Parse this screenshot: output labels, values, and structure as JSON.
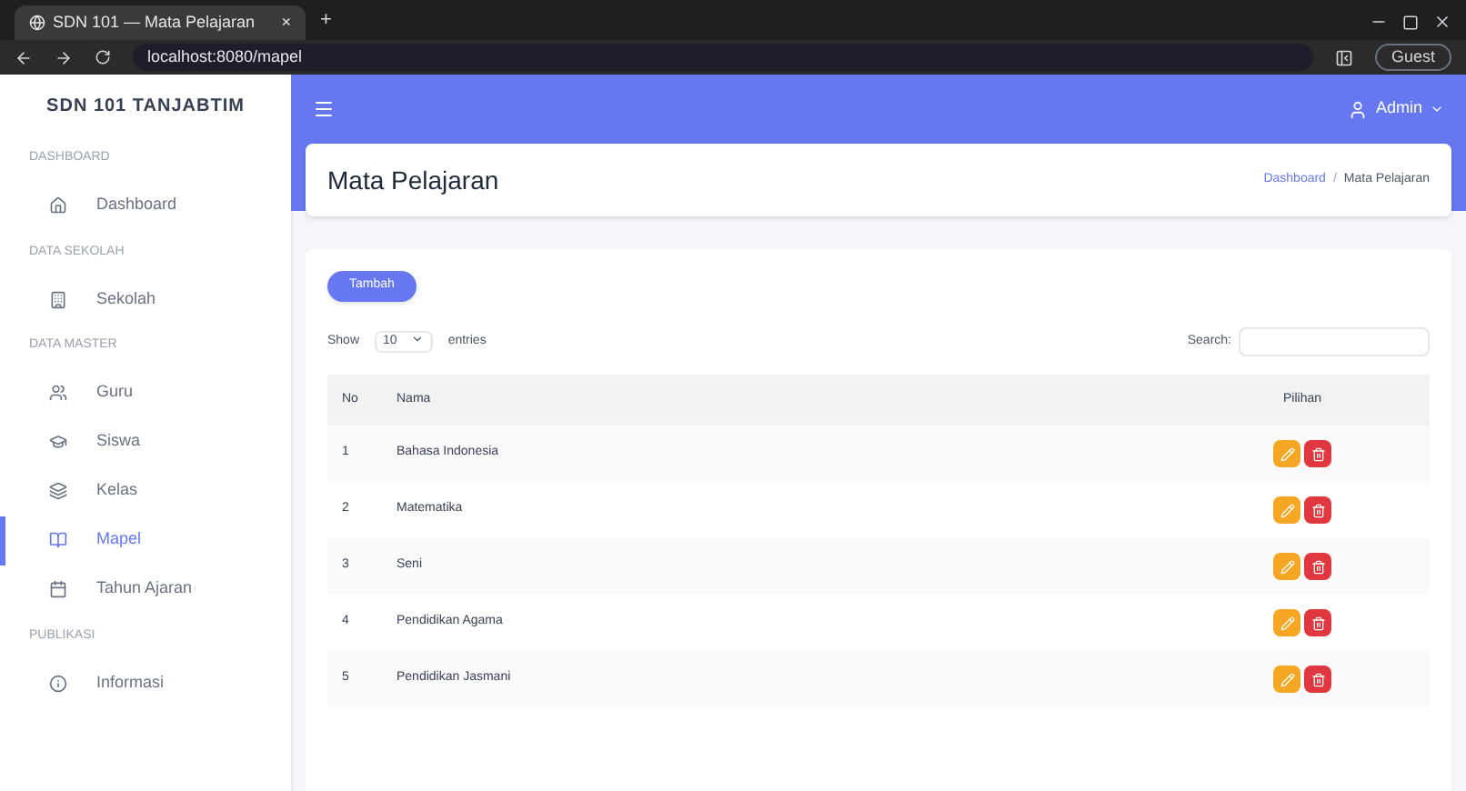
{
  "browser": {
    "tab_title": "SDN 101 — Mata Pelajaran",
    "tab_close": "×",
    "new_tab": "+",
    "url": "localhost:8080/mapel",
    "profile": "Guest"
  },
  "sidebar": {
    "brand": "SDN 101 TANJABTIM",
    "sections": [
      {
        "title": "DASHBOARD",
        "items": [
          {
            "label": "Dashboard",
            "selected": false
          }
        ]
      },
      {
        "title": "DATA SEKOLAH",
        "items": [
          {
            "label": "Sekolah",
            "selected": false
          }
        ]
      },
      {
        "title": "DATA MASTER",
        "items": [
          {
            "label": "Guru",
            "selected": false
          },
          {
            "label": "Siswa",
            "selected": false
          },
          {
            "label": "Kelas",
            "selected": false
          },
          {
            "label": "Mapel",
            "selected": true
          },
          {
            "label": "Tahun Ajaran",
            "selected": false
          }
        ]
      },
      {
        "title": "PUBLIKASI",
        "items": [
          {
            "label": "Informasi",
            "selected": false
          }
        ]
      }
    ]
  },
  "navbar": {
    "user": "Admin"
  },
  "header": {
    "title": "Mata Pelajaran",
    "breadcrumb": [
      "Dashboard",
      "Mata Pelajaran"
    ],
    "breadcrumb_separator": "/"
  },
  "card": {
    "add_button": "Tambah",
    "show_label": "Show",
    "page_size": "10",
    "entries_label": "entries",
    "search_label": "Search:"
  },
  "table": {
    "columns": [
      "No",
      "Nama",
      "Pilihan"
    ],
    "rows": [
      {
        "no": "1",
        "name": "Bahasa Indonesia"
      },
      {
        "no": "2",
        "name": "Matematika"
      },
      {
        "no": "3",
        "name": "Seni"
      },
      {
        "no": "4",
        "name": "Pendidikan Agama"
      },
      {
        "no": "5",
        "name": "Pendidikan Jasmani"
      }
    ]
  }
}
